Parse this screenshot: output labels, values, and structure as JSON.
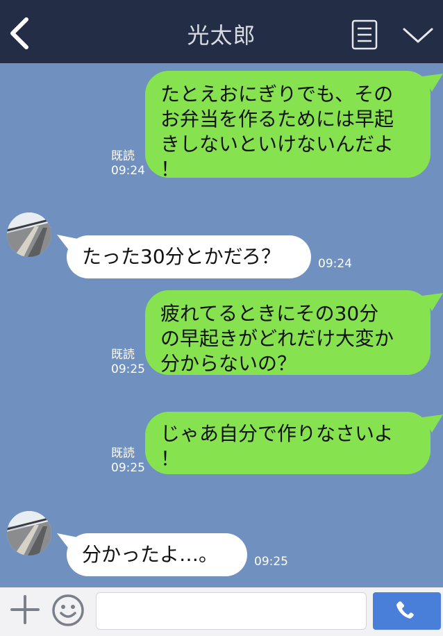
{
  "header": {
    "title": "光太郎",
    "back_icon": "chevron-left-icon",
    "menu_icon": "document-list-icon",
    "expand_icon": "chevron-down-icon"
  },
  "messages": [
    {
      "direction": "outgoing",
      "line1": "たとえおにぎりでも、その",
      "line2": "お弁当を作るためには早起",
      "line3": "きしないといけないんだよ",
      "line4": "！",
      "read": "既読",
      "time": "09:24"
    },
    {
      "direction": "incoming",
      "text": "たった30分とかだろ？",
      "time": "09:24"
    },
    {
      "direction": "outgoing",
      "line1": "疲れてるときにその30分",
      "line2": "の早起きがどれだけ大変か",
      "line3": "分からないの？",
      "read": "既読",
      "time": "09:25"
    },
    {
      "direction": "outgoing",
      "line1": "じゃあ自分で作りなさいよ",
      "line2": "！",
      "read": "既読",
      "time": "09:25"
    },
    {
      "direction": "incoming",
      "text": "分かったよ…。",
      "time": "09:25"
    }
  ],
  "footer": {
    "plus_icon": "plus-icon",
    "emoji_icon": "smiley-icon",
    "input_value": "",
    "send_icon": "phone-icon"
  },
  "colors": {
    "header_bg": "#232d45",
    "chat_bg": "#7091c0",
    "outgoing_bubble": "#86e24f",
    "incoming_bubble": "#ffffff",
    "send_button": "#4a7fd9"
  }
}
